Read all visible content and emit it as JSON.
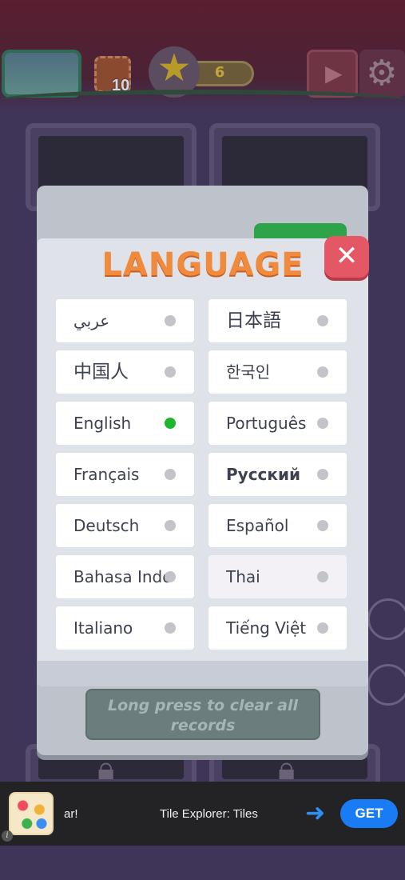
{
  "header": {
    "stamp_count": "10",
    "star_count": "6",
    "star_icon": "star-icon",
    "tv_icon": "video-ad-icon",
    "gear_icon": "gear-icon"
  },
  "dialog": {
    "title": "LANGUAGE",
    "close_icon": "close-icon",
    "close_glyph": "✕",
    "selected_color": "#1fb52e",
    "title_color": "#f08a3c",
    "languages": [
      {
        "label": "عربي",
        "selected": false
      },
      {
        "label": "日本語",
        "selected": false
      },
      {
        "label": "中国人",
        "selected": false
      },
      {
        "label": "한국인",
        "selected": false
      },
      {
        "label": "English",
        "selected": true
      },
      {
        "label": "Português",
        "selected": false
      },
      {
        "label": "Français",
        "selected": false
      },
      {
        "label": "Русский",
        "selected": false
      },
      {
        "label": "Deutsch",
        "selected": false
      },
      {
        "label": "Español",
        "selected": false
      },
      {
        "label": "Bahasa Indo",
        "selected": false
      },
      {
        "label": "Thai",
        "selected": false
      },
      {
        "label": "Italiano",
        "selected": false
      },
      {
        "label": "Tiếng Việt",
        "selected": false
      }
    ]
  },
  "records": {
    "clear_label": "Long press to clear all records"
  },
  "ad": {
    "fragment": "ar!",
    "app_title": "Tile Explorer: Tiles",
    "get_label": "GET",
    "info_glyph": "i",
    "arrow_glyph": "➜",
    "accent": "#1a7cf5"
  }
}
